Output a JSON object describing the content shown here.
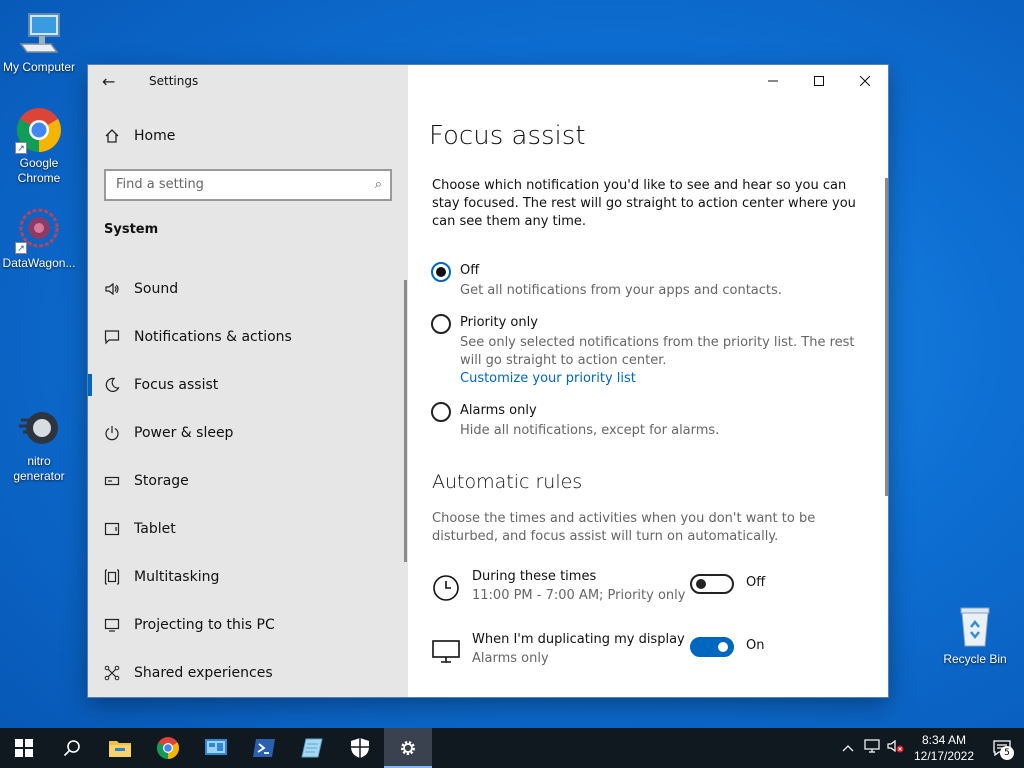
{
  "desktop": {
    "icons": [
      {
        "label": "My Computer",
        "icon": "computer-icon"
      },
      {
        "label": "Google Chrome",
        "icon": "chrome-icon"
      },
      {
        "label": "DataWagon...",
        "icon": "datawagon-icon"
      },
      {
        "label": "nitro generator",
        "icon": "nitro-icon"
      },
      {
        "label": "Recycle Bin",
        "icon": "recycle-bin-icon"
      }
    ]
  },
  "window": {
    "title": "Settings",
    "controls": {
      "minimize": "—",
      "maximize": "☐",
      "close": "✕"
    }
  },
  "nav": {
    "home": "Home",
    "search_placeholder": "Find a setting",
    "section": "System",
    "items": [
      {
        "label": "Sound",
        "icon": "speaker-icon",
        "active": false
      },
      {
        "label": "Notifications & actions",
        "icon": "notifications-icon",
        "active": false
      },
      {
        "label": "Focus assist",
        "icon": "moon-icon",
        "active": true
      },
      {
        "label": "Power & sleep",
        "icon": "power-icon",
        "active": false
      },
      {
        "label": "Storage",
        "icon": "storage-icon",
        "active": false
      },
      {
        "label": "Tablet",
        "icon": "tablet-icon",
        "active": false
      },
      {
        "label": "Multitasking",
        "icon": "multitasking-icon",
        "active": false
      },
      {
        "label": "Projecting to this PC",
        "icon": "projecting-icon",
        "active": false
      },
      {
        "label": "Shared experiences",
        "icon": "shared-icon",
        "active": false
      }
    ]
  },
  "content": {
    "title": "Focus assist",
    "intro": "Choose which notification you'd like to see and hear so you can stay focused. The rest will go straight to action center where you can see them any time.",
    "options": [
      {
        "label": "Off",
        "desc": "Get all notifications from your apps and contacts.",
        "checked": true
      },
      {
        "label": "Priority only",
        "desc": "See only selected notifications from the priority list. The rest will go straight to action center.",
        "link": "Customize your priority list",
        "checked": false
      },
      {
        "label": "Alarms only",
        "desc": "Hide all notifications, except for alarms.",
        "checked": false
      }
    ],
    "rules_title": "Automatic rules",
    "rules_desc": "Choose the times and activities when you don't want to be disturbed, and focus assist will turn on automatically.",
    "rules": [
      {
        "title": "During these times",
        "sub": "11:00 PM - 7:00 AM; Priority only",
        "state": "Off",
        "on": false,
        "icon": "clock-icon"
      },
      {
        "title": "When I'm duplicating my display",
        "sub": "Alarms only",
        "state": "On",
        "on": true,
        "icon": "monitor-icon"
      }
    ]
  },
  "taskbar": {
    "time": "8:34 AM",
    "date": "12/17/2022",
    "notification_count": "5"
  }
}
